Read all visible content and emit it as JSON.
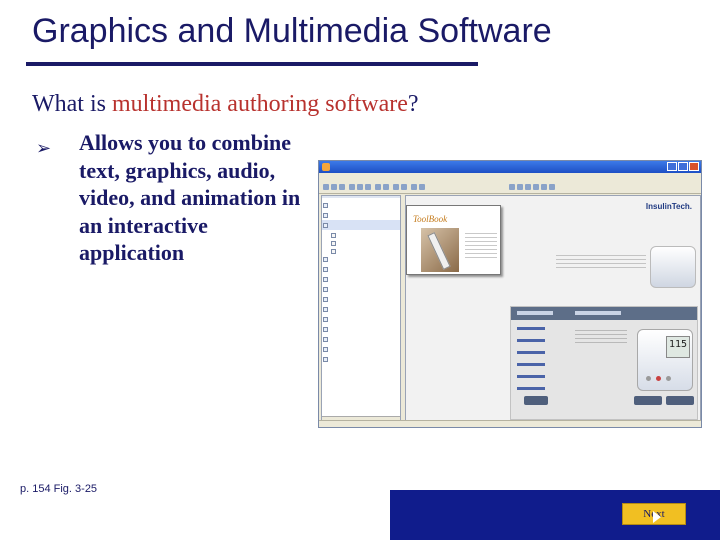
{
  "slide": {
    "title": "Graphics and Multimedia Software",
    "question_prefix": "What is ",
    "question_highlight": "multimedia authoring software",
    "question_suffix": "?",
    "bullet": "Allows you to combine text, graphics, audio, video, and animation in an interactive application",
    "caption": "p. 154 Fig. 3-25",
    "next_label": "Next",
    "colors": {
      "title": "#1a1a66",
      "highlight": "#b8322e",
      "navbar": "#101c8c",
      "button": "#f1bf22"
    }
  },
  "screenshot": {
    "thumbnail_logo": "ToolBook",
    "brand_name": "InsulinTech.",
    "device_reading": "115"
  }
}
